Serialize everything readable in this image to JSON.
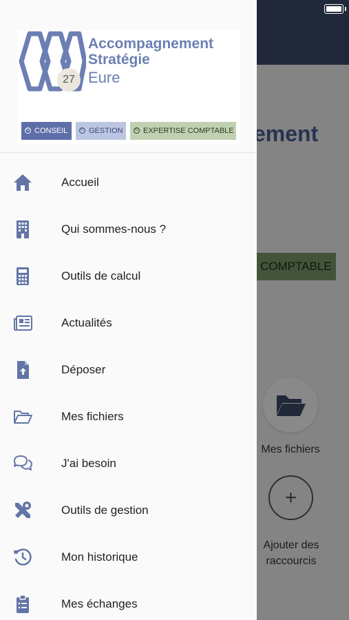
{
  "colors": {
    "accent": "#5e6ea9",
    "icon": "#6375a6",
    "header_bg": "#3c4a6a"
  },
  "logo": {
    "line1": "Accompagnement",
    "line2": "Stratégie",
    "line3": "Eure",
    "badge": "27",
    "tags": [
      {
        "symbol": "©",
        "label": "CONSEIL"
      },
      {
        "symbol": "©",
        "label": "GESTION"
      },
      {
        "symbol": "©",
        "label": "EXPERTISE COMPTABLE"
      }
    ]
  },
  "menu": {
    "items": [
      {
        "label": "Accueil",
        "icon": "home-icon"
      },
      {
        "label": "Qui sommes-nous ?",
        "icon": "building-icon"
      },
      {
        "label": "Outils de calcul",
        "icon": "calculator-icon"
      },
      {
        "label": "Actualités",
        "icon": "newspaper-icon"
      },
      {
        "label": "Déposer",
        "icon": "file-upload-icon"
      },
      {
        "label": "Mes fichiers",
        "icon": "folder-open-icon"
      },
      {
        "label": "J'ai besoin",
        "icon": "comments-icon"
      },
      {
        "label": "Outils de gestion",
        "icon": "tools-icon"
      },
      {
        "label": "Mon historique",
        "icon": "history-icon"
      },
      {
        "label": "Mes échanges",
        "icon": "clipboard-icon"
      }
    ]
  },
  "background": {
    "title_fragment": "ement",
    "chip": "COMPTABLE",
    "shortcut1": "Mes fichiers",
    "shortcut2_line1": "Ajouter des",
    "shortcut2_line2": "raccourcis",
    "plus": "+"
  }
}
